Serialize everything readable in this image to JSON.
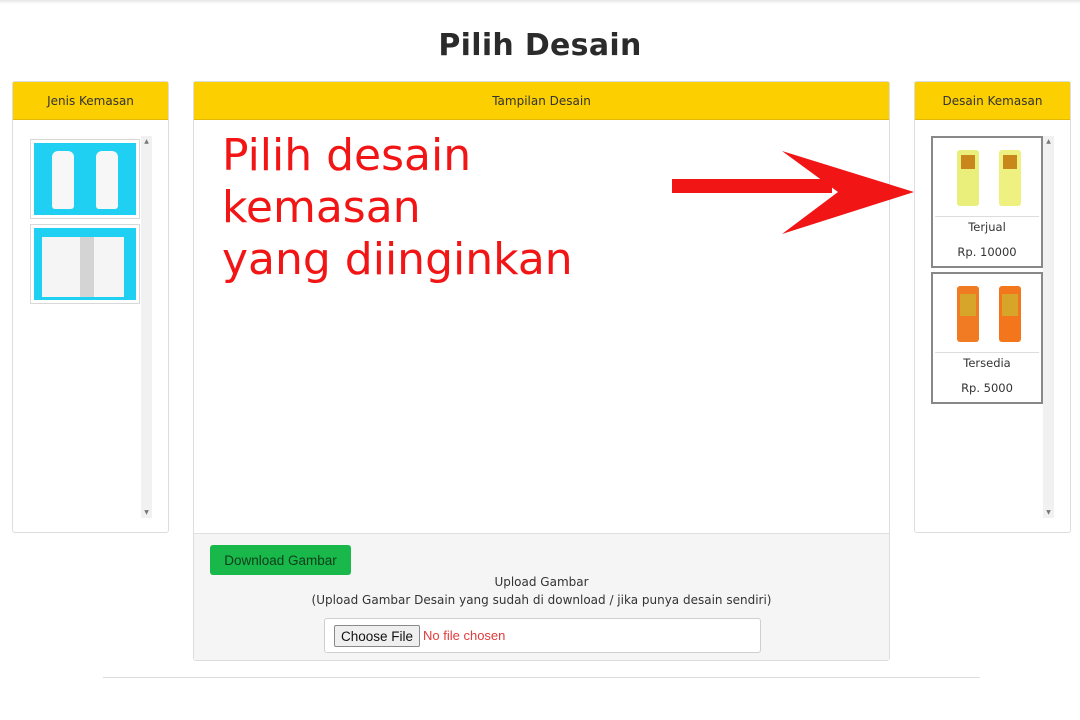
{
  "page": {
    "title": "Pilih Desain"
  },
  "left_panel": {
    "header": "Jenis Kemasan",
    "thumbnails": [
      "tube-pair-icon",
      "box-pair-icon"
    ]
  },
  "center_panel": {
    "header": "Tampilan Desain",
    "annotation_line1": "Pilih desain kemasan",
    "annotation_line2": "yang diinginkan",
    "download_label": "Download Gambar",
    "upload_title": "Upload Gambar",
    "upload_subtitle": "(Upload Gambar Desain yang sudah di download / jika punya desain sendiri)",
    "file_button_label": "Choose File",
    "file_status": "No file chosen"
  },
  "right_panel": {
    "header": "Desain Kemasan",
    "designs": [
      {
        "name": "Terjual",
        "price": "Rp. 10000",
        "color": "#e9ef7a"
      },
      {
        "name": "Tersedia",
        "price": "Rp. 5000",
        "color": "#f07b22"
      }
    ]
  },
  "colors": {
    "accent": "#fbcf00",
    "download": "#18b84a",
    "annotation": "#f11515",
    "thumb_bg": "#1fd0f2"
  }
}
